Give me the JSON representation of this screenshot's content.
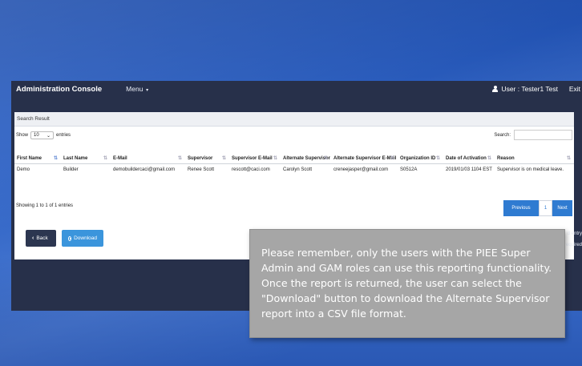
{
  "header": {
    "title": "Administration Console",
    "menu_label": "Menu",
    "user_label": "User : Tester1 Test",
    "exit_label": "Exit"
  },
  "panel": {
    "title": "Search Result",
    "show_label": "Show",
    "entries_value": "10",
    "entries_label": "entries",
    "search_label": "Search:"
  },
  "table": {
    "columns": [
      "First Name",
      "Last Name",
      "E-Mail",
      "Supervisor",
      "Supervisor E-Mail",
      "Alternate Supervisor",
      "Alternate Supervisor E-Mail",
      "Organization ID",
      "Date of Activation",
      "Reason"
    ],
    "rows": [
      [
        "Demo",
        "Builder",
        "demobuildercaci@gmail.com",
        "Renee Scott",
        "rescott@caci.com",
        "Carolyn Scott",
        "creneejasper@gmail.com",
        "S0512A",
        "2019/01/03 1104 EST",
        "Supervisor is on medical leave."
      ]
    ]
  },
  "footer": {
    "info": "Showing 1 to 1 of 1 entries",
    "previous": "Previous",
    "page": "1",
    "next": "Next"
  },
  "buttons": {
    "back": "Back",
    "download": "Download"
  },
  "cutoff": {
    "line1": "d entry",
    "line2": "required"
  },
  "callout": {
    "text": "Please remember, only the users with the PIEE Super Admin and GAM roles can use this reporting functionality.  Once the report is returned, the user can select the \"Download\" button to download the Alternate Supervisor report into a CSV file format."
  },
  "colors": {
    "navbar": "#27304a",
    "primary_button": "#2f7bd1",
    "download_button": "#3b95dc",
    "callout": "#a6a6a6"
  }
}
